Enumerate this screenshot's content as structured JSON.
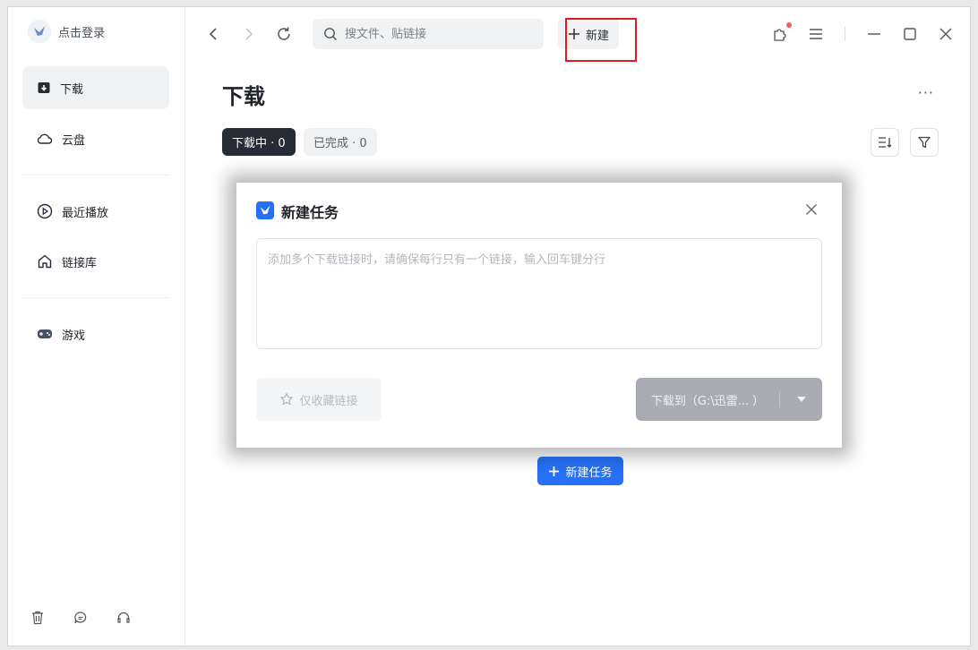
{
  "sidebar": {
    "login_label": "点击登录",
    "items": [
      {
        "label": "下载"
      },
      {
        "label": "云盘"
      },
      {
        "label": "最近播放"
      },
      {
        "label": "链接库"
      },
      {
        "label": "游戏"
      }
    ]
  },
  "toolbar": {
    "search_placeholder": "搜文件、贴链接",
    "new_label": "新建"
  },
  "main": {
    "title": "下载",
    "more": "···",
    "tabs": [
      {
        "label": "下载中 · 0"
      },
      {
        "label": "已完成 · 0"
      }
    ],
    "new_task_label": "新建任务"
  },
  "dialog": {
    "title": "新建任务",
    "placeholder": "添加多个下载链接时，请确保每行只有一个链接，输入回车键分行",
    "favorite_label": "仅收藏链接",
    "download_label": "下载到（G:\\迅雷... ）"
  },
  "colors": {
    "accent": "#2670f5",
    "active_tab": "#262b36",
    "highlight": "#e01b24"
  }
}
